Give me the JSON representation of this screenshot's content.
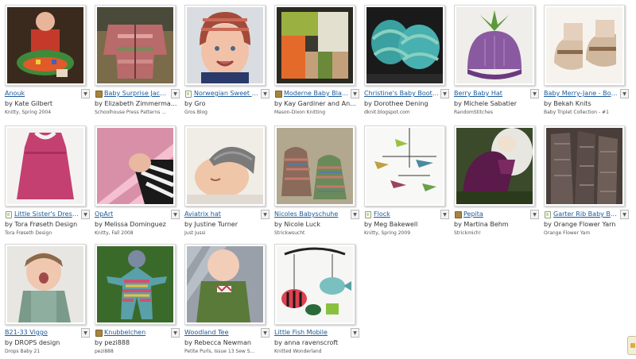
{
  "patterns": [
    {
      "title": "Anouk",
      "designer": "by Kate Gilbert",
      "source": "Knitty, Spring 2004",
      "icon": "none"
    },
    {
      "title": "Baby Surprise Jacket",
      "designer": "by Elizabeth Zimmerma...",
      "source": "Schoolhouse Press Patterns ...",
      "icon": "book"
    },
    {
      "title": "Norwegian Sweet Ba...",
      "designer": "by Gro",
      "source": "Gros Blog",
      "icon": "web"
    },
    {
      "title": "Moderne Baby Blanket",
      "designer": "by Kay Gardiner and An...",
      "source": "Mason-Dixon Knitting",
      "icon": "book"
    },
    {
      "title": "Christine's Baby Booties",
      "designer": "by Dorothee Dening",
      "source": "dknit.blogspot.com",
      "icon": "none"
    },
    {
      "title": "Berry Baby Hat",
      "designer": "by Michele Sabatier",
      "source": "RandomStitches",
      "icon": "none"
    },
    {
      "title": "Baby Merry-Jane - Booti...",
      "designer": "by Bekah Knits",
      "source": "Baby Triplet Collection - #1",
      "icon": "none"
    },
    {
      "title": "Little Sister's Dress (...",
      "designer": "by Tora Frøseth Design",
      "source": "Tora Frøseth Design",
      "icon": "web"
    },
    {
      "title": "OpArt",
      "designer": "by Melissa Dominguez",
      "source": "Knitty, Fall 2008",
      "icon": "none"
    },
    {
      "title": "Aviatrix hat",
      "designer": "by Justine Turner",
      "source": "Just Jussi",
      "icon": "none"
    },
    {
      "title": "Nicoles Babyschuhe",
      "designer": "by Nicole Luck",
      "source": "Strickwsucht",
      "icon": "none"
    },
    {
      "title": "Flock",
      "designer": "by Meg Bakewell",
      "source": "Knitty, Spring 2009",
      "icon": "web"
    },
    {
      "title": "Pepita",
      "designer": "by Martina Behm",
      "source": "Strickmich!",
      "icon": "book"
    },
    {
      "title": "Garter Rib Baby Blan...",
      "designer": "by Orange Flower Yarn",
      "source": "Orange Flower Yarn",
      "icon": "web"
    },
    {
      "title": "B21-33 Viggo",
      "designer": "by DROPS design",
      "source": "Drops Baby 21",
      "icon": "none"
    },
    {
      "title": "Knubbelchen",
      "designer": "by pezi888",
      "source": "pezi888",
      "icon": "book"
    },
    {
      "title": "Woodland Tee",
      "designer": "by Rebecca Newman",
      "source": "Petite Purls, Issue 13 Sew S...",
      "icon": "none"
    },
    {
      "title": "Little Fish Mobile",
      "designer": "by anna ravenscroft",
      "source": "Knitted Wonderland",
      "icon": "none"
    }
  ],
  "dropdown_glyph": "▼"
}
